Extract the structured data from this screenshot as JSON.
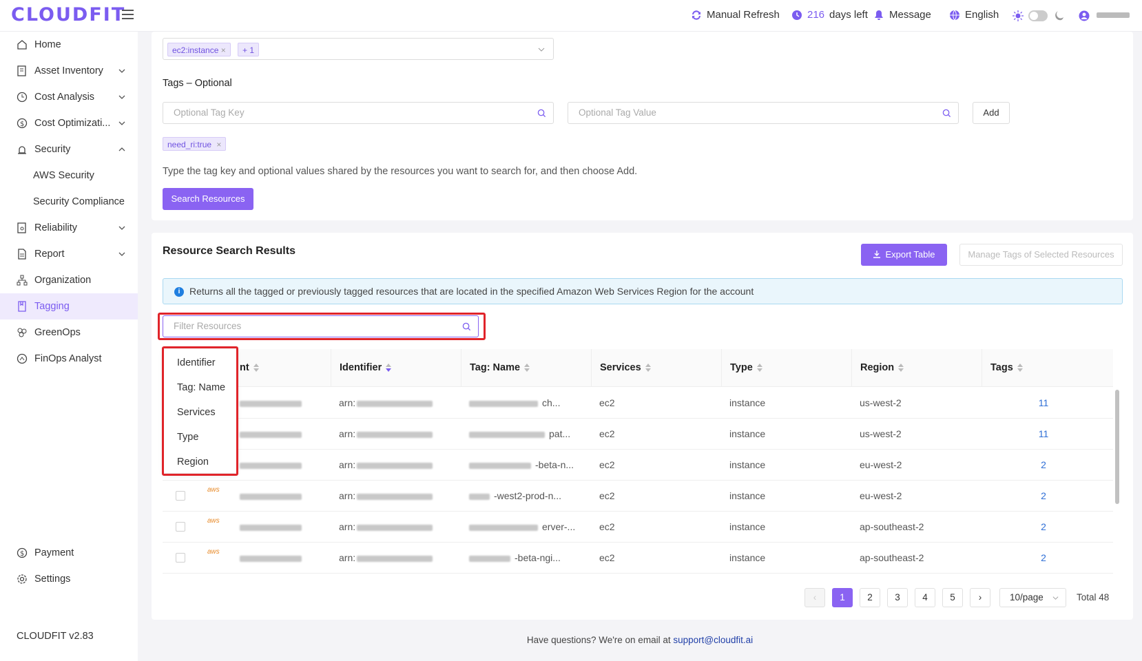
{
  "app": {
    "logo": "CLOUDFIT",
    "version": "CLOUDFIT v2.83"
  },
  "topbar": {
    "refresh_label": "Manual Refresh",
    "days_count": "216",
    "days_suffix": "days left",
    "message_label": "Message",
    "language_label": "English"
  },
  "sidebar": {
    "items": [
      {
        "label": "Home",
        "icon": "home-icon"
      },
      {
        "label": "Asset Inventory",
        "icon": "inventory-icon"
      },
      {
        "label": "Cost Analysis",
        "icon": "clock-icon"
      },
      {
        "label": "Cost Optimizati...",
        "icon": "dollar-icon"
      },
      {
        "label": "Security",
        "icon": "alarm-icon"
      },
      {
        "label": "AWS Security"
      },
      {
        "label": "Security Compliance"
      },
      {
        "label": "Reliability",
        "icon": "reliability-icon"
      },
      {
        "label": "Report",
        "icon": "report-icon"
      },
      {
        "label": "Organization",
        "icon": "organization-icon"
      },
      {
        "label": "Tagging",
        "icon": "tag-icon"
      },
      {
        "label": "GreenOps",
        "icon": "greenops-icon"
      },
      {
        "label": "FinOps Analyst",
        "icon": "finops-icon"
      }
    ],
    "bottom": [
      {
        "label": "Payment",
        "icon": "dollar-icon"
      },
      {
        "label": "Settings",
        "icon": "gear-icon"
      }
    ]
  },
  "search": {
    "resource_chips": [
      "ec2:instance",
      "+ 1"
    ],
    "tags_label": "Tags – Optional",
    "tag_key_placeholder": "Optional Tag Key",
    "tag_value_placeholder": "Optional Tag Value",
    "add_label": "Add",
    "tag_chip": "need_ri:true",
    "hint": "Type the tag key and optional values shared by the resources you want to search for, and then choose Add.",
    "search_button": "Search Resources"
  },
  "results": {
    "title": "Resource Search Results",
    "export_label": "Export Table",
    "manage_label": "Manage Tags of Selected Resources",
    "info": "Returns all the tagged or previously tagged resources that are located in the specified Amazon Web Services Region for the account",
    "filter_placeholder": "Filter Resources",
    "columns": [
      "nt",
      "Identifier",
      "Tag: Name",
      "Services",
      "Type",
      "Region",
      "Tags"
    ],
    "rows": [
      {
        "identifier": "arn:",
        "tag_name": "ch...",
        "service": "ec2",
        "type": "instance",
        "region": "us-west-2",
        "tags": "11"
      },
      {
        "identifier": "arn:",
        "tag_name": "pat...",
        "service": "ec2",
        "type": "instance",
        "region": "us-west-2",
        "tags": "11"
      },
      {
        "identifier": "arn:",
        "tag_name": "-beta-n...",
        "service": "ec2",
        "type": "instance",
        "region": "eu-west-2",
        "tags": "2"
      },
      {
        "identifier": "arn:",
        "tag_name": "-west2-prod-n...",
        "service": "ec2",
        "type": "instance",
        "region": "eu-west-2",
        "tags": "2"
      },
      {
        "identifier": "arn:",
        "tag_name": "erver-...",
        "service": "ec2",
        "type": "instance",
        "region": "ap-southeast-2",
        "tags": "2"
      },
      {
        "identifier": "arn:",
        "tag_name": "-beta-ngi...",
        "service": "ec2",
        "type": "instance",
        "region": "ap-southeast-2",
        "tags": "2"
      }
    ],
    "aws_badge": "aws",
    "dropdown_options": [
      "Identifier",
      "Tag: Name",
      "Services",
      "Type",
      "Region"
    ]
  },
  "pagination": {
    "pages": [
      "1",
      "2",
      "3",
      "4",
      "5"
    ],
    "prev": "‹",
    "next": "›",
    "page_size": "10/page",
    "total": "Total 48"
  },
  "footer": {
    "text": "Have questions? We're on email at ",
    "email": "support@cloudfit.ai"
  },
  "colors": {
    "accent": "#7b5cf0",
    "highlight": "#e0242a"
  }
}
